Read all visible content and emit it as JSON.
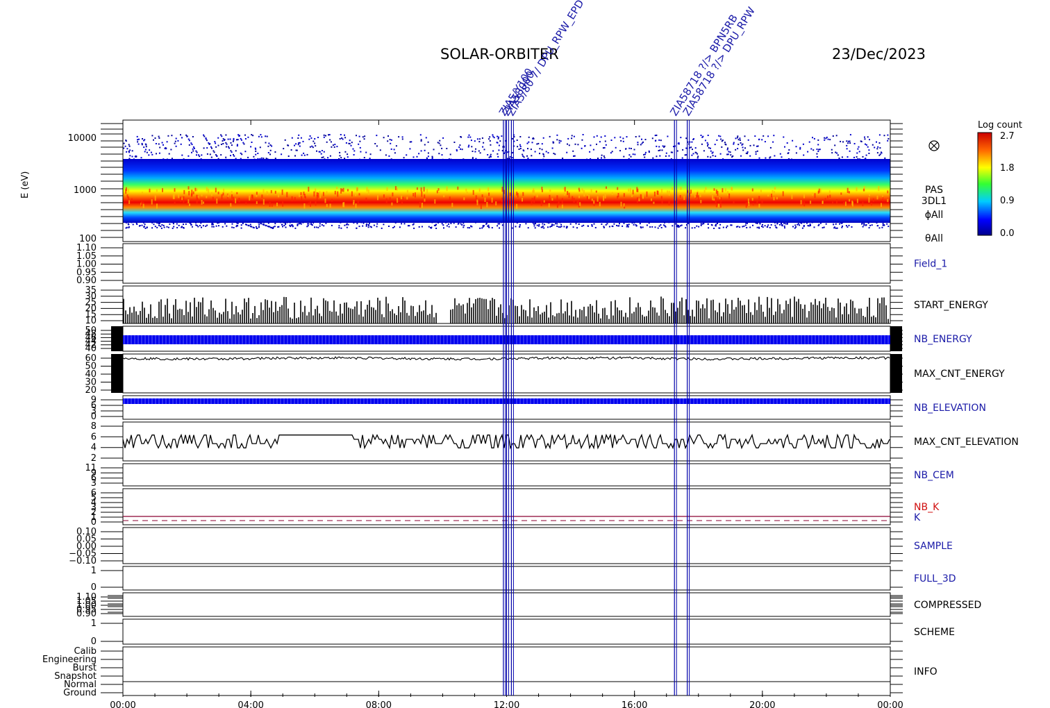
{
  "header": {
    "mission": "SOLAR-ORBITER",
    "date": "23/Dec/2023"
  },
  "colors": {
    "axis": "#000000",
    "blue_label": "#1a1aa8",
    "red_label": "#d01010",
    "trace_blue": "#0000ee",
    "marker_line": "#0000aa"
  },
  "spectrogram": {
    "ylabel": "E (eV)",
    "y_ticks": [
      "10000",
      "1000",
      "100"
    ],
    "side_labels": [
      "PAS",
      "3DL1",
      "ϕAll",
      "θAll"
    ],
    "colorbar": {
      "title": "Log count",
      "ticks": [
        "2.7",
        "1.8",
        "0.9",
        "0.0"
      ],
      "range": [
        0.0,
        2.7
      ]
    },
    "symbol_icon": "circled-times-icon"
  },
  "chart_data": {
    "type": "line",
    "x_axis": {
      "range_hours": [
        0,
        24
      ],
      "tick_hours": [
        0,
        4,
        8,
        12,
        16,
        20,
        24
      ],
      "tick_labels": [
        "00:00",
        "04:00",
        "08:00",
        "12:00",
        "16:00",
        "20:00",
        "00:00"
      ]
    },
    "panels": [
      {
        "name": "Field_1",
        "color": "blue",
        "ticks": [
          "1.10",
          "1.05",
          "1.00",
          "0.95",
          "0.90"
        ],
        "ylim": [
          0.9,
          1.1
        ]
      },
      {
        "name": "START_ENERGY",
        "color": "black",
        "ticks": [
          "35",
          "30",
          "25",
          "20",
          "15",
          "10"
        ],
        "ylim": [
          10,
          35
        ],
        "typical_range": [
          13,
          28
        ]
      },
      {
        "name": "NB_ENERGY",
        "color": "blue",
        "ticks": [
          "50",
          "48",
          "46",
          "44",
          "42",
          "40"
        ],
        "ylim": [
          40,
          50
        ]
      },
      {
        "name": "MAX_CNT_ENERGY",
        "color": "black",
        "ticks": [
          "60",
          "50",
          "40",
          "30",
          "20"
        ],
        "ylim": [
          15,
          60
        ],
        "typical_value": 55
      },
      {
        "name": "NB_ELEVATION",
        "color": "blue",
        "ticks": [
          "9",
          "6",
          "3",
          "0"
        ],
        "ylim": [
          0,
          9
        ]
      },
      {
        "name": "MAX_CNT_ELEVATION",
        "color": "black",
        "ticks": [
          "8",
          "6",
          "4",
          "2"
        ],
        "ylim": [
          0,
          9
        ],
        "typical_range": [
          3,
          6
        ]
      },
      {
        "name": "NB_CEM",
        "color": "blue",
        "ticks": [
          "11",
          "9",
          "6",
          "3"
        ],
        "ylim": [
          0,
          12
        ]
      },
      {
        "name": "NB_K",
        "color": "red",
        "second_label": "K",
        "ticks": [
          "6",
          "5",
          "4",
          "3",
          "2",
          "1",
          "0"
        ],
        "ylim": [
          0,
          6
        ]
      },
      {
        "name": "SAMPLE",
        "color": "blue",
        "ticks": [
          "0.10",
          "0.05",
          "0.00",
          "−0.05",
          "−0.10"
        ],
        "ylim": [
          -0.1,
          0.1
        ]
      },
      {
        "name": "FULL_3D",
        "color": "blue",
        "ticks": [
          "1",
          "0"
        ],
        "ylim": [
          0,
          1
        ]
      },
      {
        "name": "COMPRESSED",
        "color": "black",
        "ticks": [
          "1.10",
          "1.05",
          "1.00",
          "0.95",
          "0.90"
        ],
        "ylim": [
          0.9,
          1.1
        ]
      },
      {
        "name": "SCHEME",
        "color": "black",
        "ticks": [
          "1",
          "0"
        ],
        "ylim": [
          0,
          1
        ]
      },
      {
        "name": "INFO",
        "color": "black",
        "ticks": [
          "Calib",
          "Engineering",
          "Burst",
          "Snapshot",
          "Normal",
          "Ground"
        ]
      }
    ],
    "markers": [
      {
        "hour": 11.9,
        "label": "ZIA5/Y100"
      },
      {
        "hour": 12.0,
        "label": "ZIA58000"
      },
      {
        "hour": 12.15,
        "label": "ZIA5/80 7/ DPU_RPW_EPD"
      },
      {
        "hour": 17.25,
        "label": "ZIA58718 ?/> BPN5RB"
      },
      {
        "hour": 17.65,
        "label": "ZIA58718 ?/> DPU_RPW"
      }
    ]
  }
}
